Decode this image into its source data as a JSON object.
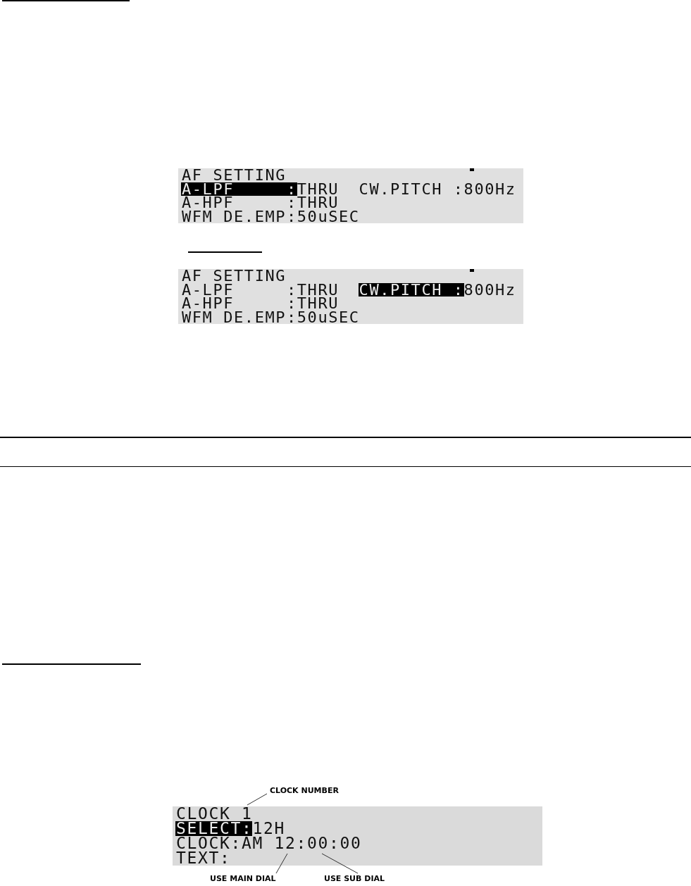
{
  "af_setting_screens": [
    {
      "title": "AF SETTING",
      "rows": [
        {
          "items": [
            {
              "label": "A-LPF",
              "separator": ":",
              "value": "THRU",
              "selected": true
            },
            {
              "label": "CW.PITCH",
              "separator": ":",
              "value": "800Hz",
              "selected": false
            }
          ]
        },
        {
          "items": [
            {
              "label": "A-HPF",
              "separator": ":",
              "value": "THRU",
              "selected": false
            }
          ]
        },
        {
          "items": [
            {
              "label": "WFM DE.EMP",
              "separator": ":",
              "value": "50uSEC",
              "selected": false
            }
          ]
        }
      ]
    },
    {
      "title": "AF SETTING",
      "rows": [
        {
          "items": [
            {
              "label": "A-LPF",
              "separator": ":",
              "value": "THRU",
              "selected": false
            },
            {
              "label": "CW.PITCH",
              "separator": ":",
              "value": "800Hz",
              "selected": true
            }
          ]
        },
        {
          "items": [
            {
              "label": "A-HPF",
              "separator": ":",
              "value": "THRU",
              "selected": false
            }
          ]
        },
        {
          "items": [
            {
              "label": "WFM DE.EMP",
              "separator": ":",
              "value": "50uSEC",
              "selected": false
            }
          ]
        }
      ]
    }
  ],
  "clock_figure": {
    "callout_top": "CLOCK NUMBER",
    "screen": {
      "title": "CLOCK",
      "number": "1",
      "rows": [
        {
          "items": [
            {
              "label": "SELECT",
              "separator": ":",
              "value": "12H",
              "selected": true
            }
          ]
        },
        {
          "items": [
            {
              "label": "CLOCK",
              "separator": ":",
              "value": "AM 12:00:00",
              "selected": false
            }
          ]
        },
        {
          "items": [
            {
              "label": "TEXT",
              "separator": ":",
              "selected": false
            }
          ]
        }
      ]
    },
    "callouts_bottom": [
      "USE MAIN DIAL",
      "USE SUB DIAL"
    ]
  }
}
